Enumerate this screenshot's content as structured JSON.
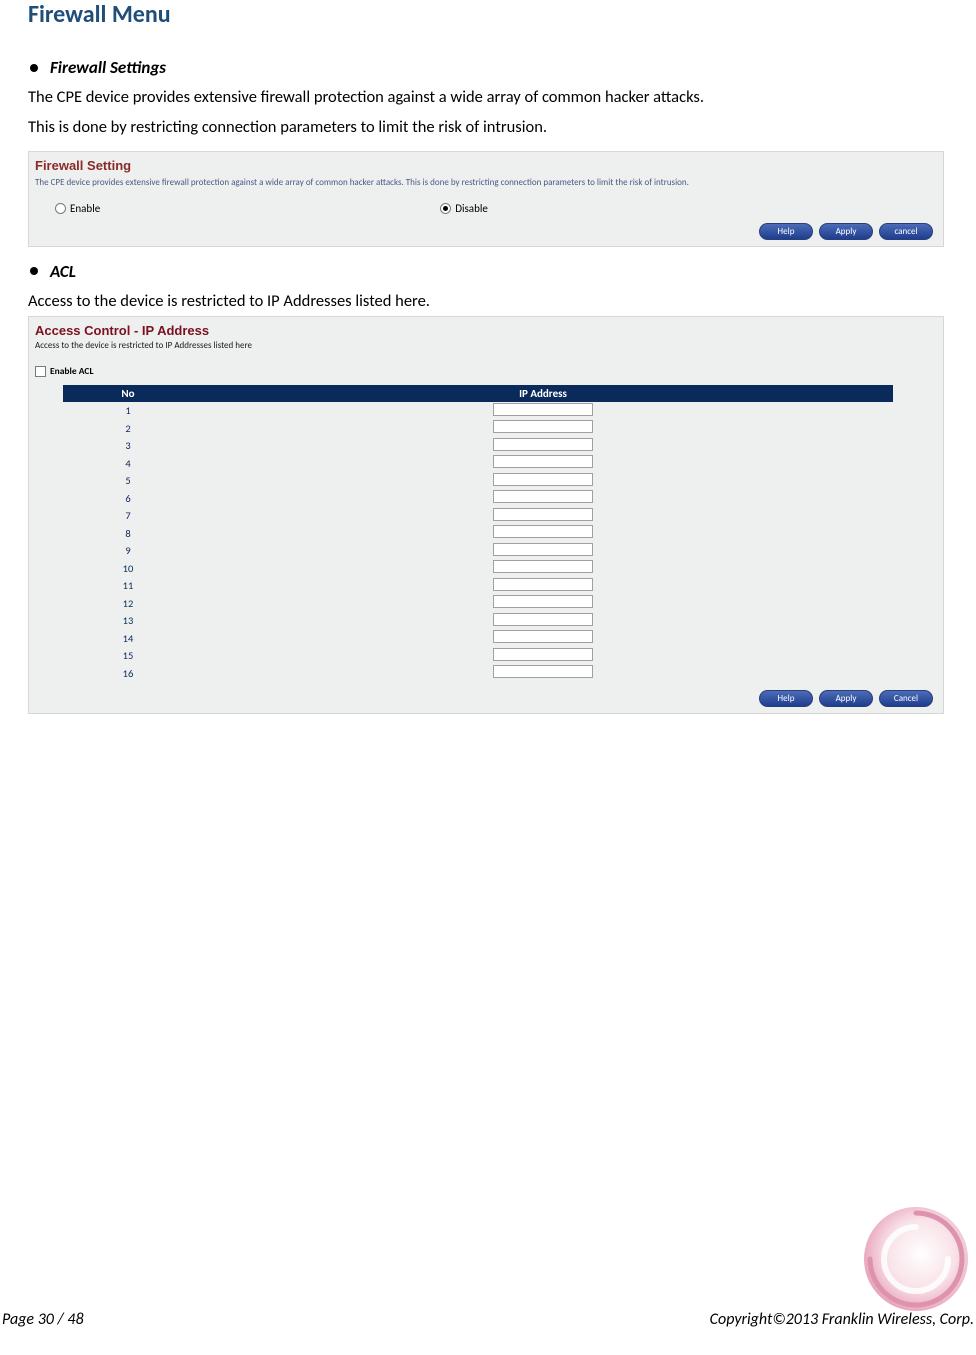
{
  "headings": {
    "main": "Firewall Menu",
    "firewall_settings": "Firewall Settings",
    "acl": "ACL"
  },
  "body": {
    "fs_line1": "The CPE device provides extensive firewall protection against a wide array of common hacker attacks.",
    "fs_line2": "This is done by restricting connection parameters to limit the risk of intrusion.",
    "acl_line1": "Access to the device is restricted to IP Addresses listed here."
  },
  "panel1": {
    "title": "Firewall Setting",
    "desc": "The CPE device provides extensive firewall protection against a wide array of common hacker attacks. This is done by restricting connection parameters to limit the risk of intrusion.",
    "enable_label": "Enable",
    "disable_label": "Disable",
    "buttons": {
      "help": "Help",
      "apply": "Apply",
      "cancel": "cancel"
    }
  },
  "panel2": {
    "title": "Access Control - IP Address",
    "desc": "Access to the device is restricted to IP Addresses listed here",
    "enable_acl_label": "Enable ACL",
    "headers": {
      "no": "No",
      "ip": "IP Address"
    },
    "rows": [
      {
        "no": "1",
        "ip": ""
      },
      {
        "no": "2",
        "ip": ""
      },
      {
        "no": "3",
        "ip": ""
      },
      {
        "no": "4",
        "ip": ""
      },
      {
        "no": "5",
        "ip": ""
      },
      {
        "no": "6",
        "ip": ""
      },
      {
        "no": "7",
        "ip": ""
      },
      {
        "no": "8",
        "ip": ""
      },
      {
        "no": "9",
        "ip": ""
      },
      {
        "no": "10",
        "ip": ""
      },
      {
        "no": "11",
        "ip": ""
      },
      {
        "no": "12",
        "ip": ""
      },
      {
        "no": "13",
        "ip": ""
      },
      {
        "no": "14",
        "ip": ""
      },
      {
        "no": "15",
        "ip": ""
      },
      {
        "no": "16",
        "ip": ""
      }
    ],
    "buttons": {
      "help": "Help",
      "apply": "Apply",
      "cancel": "Cancel"
    }
  },
  "footer": {
    "page_label": "Page  30  /  48",
    "copyright": "Copyright©2013  Franklin  Wireless, Corp."
  }
}
